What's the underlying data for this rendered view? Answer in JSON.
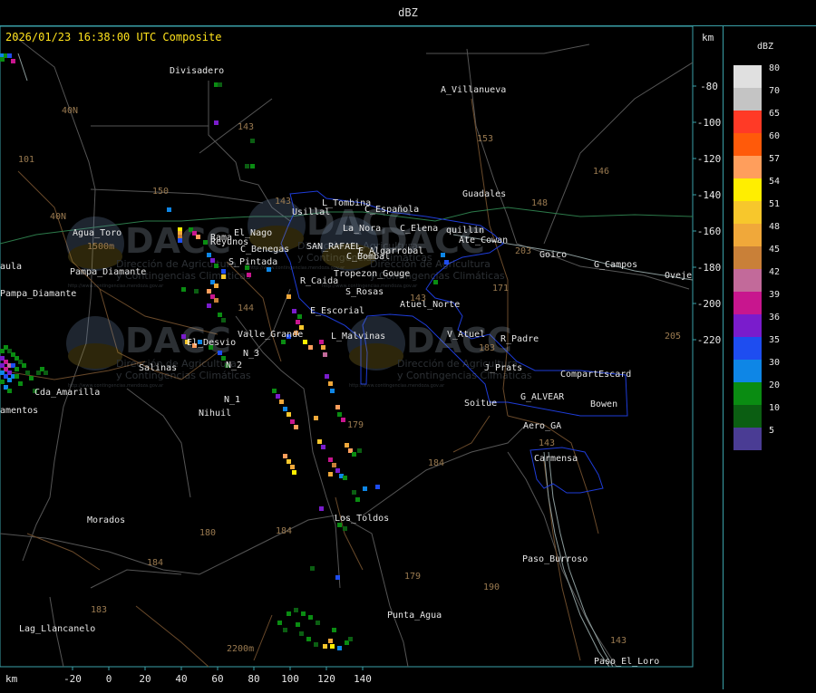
{
  "window": {
    "title": "dBZ"
  },
  "map": {
    "timestamp": "2026/01/23 16:38:00 UTC Composite",
    "unit_label_top": "km",
    "unit_label_bottom": "km",
    "x_axis": {
      "ticks": [
        -20,
        0,
        20,
        40,
        60,
        80,
        100,
        120,
        140
      ]
    },
    "y_axis": {
      "ticks": [
        -80,
        -100,
        -120,
        -140,
        -160,
        -180,
        -200,
        -220
      ]
    },
    "places": [
      "Divisadero",
      "A_Villanueva",
      "Guadales",
      "Agua_Toro",
      "L_Tombina",
      "C_Española",
      "Usillal",
      "La_Nora",
      "C_Elena",
      "quillin",
      "Ate_Cowan",
      "Goico",
      "G_Campos",
      "Oveje",
      "Rama",
      "El_Nago",
      "Reyunos",
      "C_Benegas",
      "SAN_RAFAEL",
      "E_Algarrobal",
      "C_Bombal",
      "S_Pintada",
      "Pampa_Diamante",
      "R_Caida",
      "S_Rosas",
      "Tropezon_Gouge",
      "Atuel_Norte",
      "E_Escorial",
      "Valle_Grande",
      "L_Malvinas",
      "V_Atuel",
      "R_Padre",
      "El_Desvio",
      "N_3",
      "N_2",
      "Salinas",
      "N_1",
      "Nihuil",
      "Cda_Amarilla",
      "amentos",
      "J_Prats",
      "CompartEscard",
      "G_ALVEAR",
      "Bowen",
      "Soitue",
      "Aero_GA",
      "Carmensa",
      "Morados",
      "Los_Toldos",
      "Paso_Burroso",
      "Punta_Agua",
      "Lag_Llancanelo",
      "Paso_El_Loro",
      "Pampa_Diamante",
      "aula"
    ],
    "route_numbers": [
      "40N",
      "101",
      "143",
      "153",
      "146",
      "150",
      "143",
      "40N",
      "148",
      "203",
      "171",
      "144",
      "143",
      "183",
      "205",
      "179",
      "184",
      "180",
      "184",
      "184",
      "179",
      "190",
      "183",
      "143",
      "143"
    ],
    "elevations": [
      "1500m",
      "2200m"
    ],
    "watermark": {
      "brand": "DACC",
      "line1": "Dirección de Agricultura",
      "line2": "y Contingencias Climáticas",
      "url": "http://www.contingencias.mendoza.gov.ar"
    }
  },
  "legend": {
    "title": "dBZ",
    "items": [
      {
        "value": "80",
        "color": "#e0e0e0"
      },
      {
        "value": "70",
        "color": "#c4c4c4"
      },
      {
        "value": "65",
        "color": "#ff3a26"
      },
      {
        "value": "60",
        "color": "#ff5a0a"
      },
      {
        "value": "57",
        "color": "#ff9e5c"
      },
      {
        "value": "54",
        "color": "#ffee00"
      },
      {
        "value": "51",
        "color": "#f7c72c"
      },
      {
        "value": "48",
        "color": "#f0a83a"
      },
      {
        "value": "45",
        "color": "#c98038"
      },
      {
        "value": "42",
        "color": "#c26a9a"
      },
      {
        "value": "39",
        "color": "#c8168e"
      },
      {
        "value": "36",
        "color": "#7a1ccc"
      },
      {
        "value": "35",
        "color": "#1e4df0"
      },
      {
        "value": "30",
        "color": "#0e86e6"
      },
      {
        "value": "20",
        "color": "#0a8c12"
      },
      {
        "value": "10",
        "color": "#0b5e12"
      },
      {
        "value": "5",
        "color": "#4a3c94"
      }
    ]
  }
}
